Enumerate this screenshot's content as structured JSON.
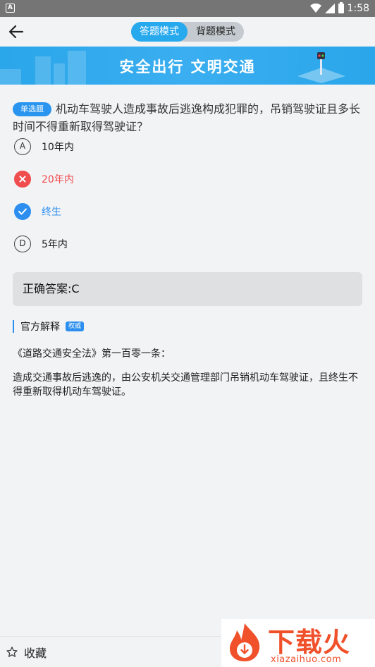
{
  "status_bar": {
    "app_icon": "A",
    "time": "1:58"
  },
  "header": {
    "mode_tabs": [
      {
        "label": "答题模式",
        "active": true
      },
      {
        "label": "背题模式",
        "active": false
      }
    ]
  },
  "banner": {
    "title": "安全出行 文明交通"
  },
  "question": {
    "type_tag": "单选题",
    "text": "机动车驾驶人造成事故后逃逸构成犯罪的，吊销驾驶证且多长时间不得重新取得驾驶证？",
    "options": [
      {
        "key": "A",
        "text": "10年内",
        "state": "normal"
      },
      {
        "key": "B",
        "text": "20年内",
        "state": "wrong"
      },
      {
        "key": "C",
        "text": "终生",
        "state": "correct"
      },
      {
        "key": "D",
        "text": "5年内",
        "state": "normal"
      }
    ]
  },
  "answer": {
    "text": "正确答案:C"
  },
  "explanation": {
    "heading": "官方解释",
    "badge": "权威",
    "paragraphs": [
      "《道路交通安全法》第一百零一条：",
      "造成交通事故后逃逸的，由公安机关交通管理部门吊销机动车驾驶证，且终生不得重新取得机动车驾驶证。"
    ]
  },
  "bottom_bar": {
    "favorite_label": "收藏"
  },
  "watermark": {
    "brand_cn": "下载火",
    "brand_url": "xiazaihuo.com"
  },
  "colors": {
    "accent": "#27a9ee",
    "wrong": "#f04d4f",
    "correct": "#2c8ff0",
    "brand": "#f0502a"
  }
}
